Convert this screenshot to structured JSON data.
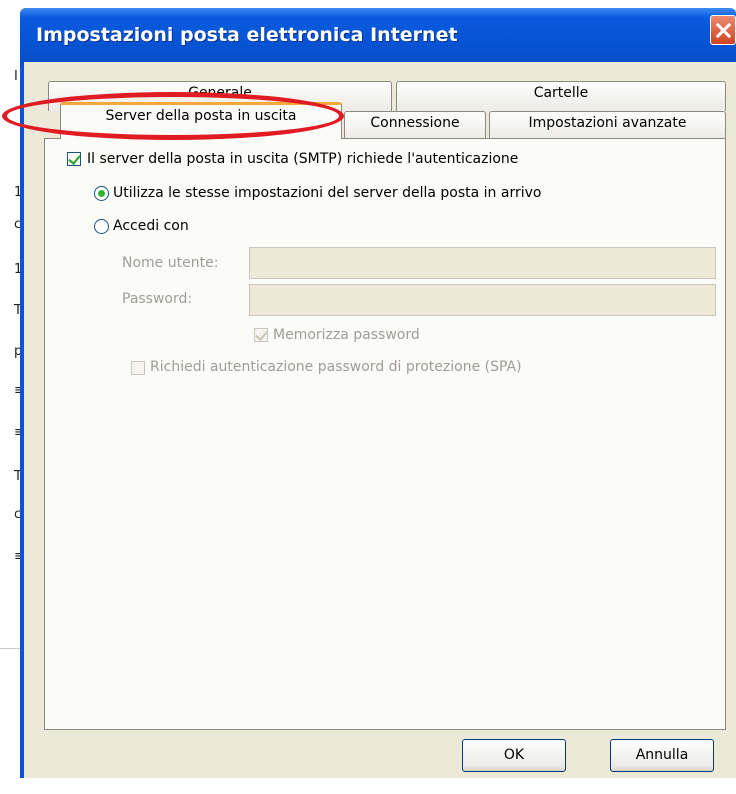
{
  "dialog": {
    "title": "Impostazioni posta elettronica Internet"
  },
  "tabs": {
    "row_back": [
      {
        "label": "Generale"
      },
      {
        "label": "Cartelle"
      }
    ],
    "row_front": [
      {
        "label": "Server della posta in uscita",
        "active": true
      },
      {
        "label": "Connessione"
      },
      {
        "label": "Impostazioni avanzate"
      }
    ]
  },
  "smtp": {
    "auth_required_label": "Il server della posta in uscita (SMTP) richiede l'autenticazione",
    "auth_required_checked": true,
    "use_same_label": "Utilizza le stesse impostazioni del server della posta in arrivo",
    "logon_with_label": "Accedi con",
    "selected_option": "use_same",
    "username_label": "Nome utente:",
    "username_value": "",
    "password_label": "Password:",
    "password_value": "",
    "remember_label": "Memorizza password",
    "remember_checked": true,
    "spa_label": "Richiedi autenticazione password di protezione (SPA)",
    "spa_checked": false
  },
  "buttons": {
    "ok": "OK",
    "cancel": "Annulla"
  },
  "annotation": {
    "color": "#e11b22",
    "shape": "ellipse",
    "target": "Server della posta in uscita"
  },
  "background_glyphs": [
    "I",
    "1",
    "c",
    "1",
    "T",
    "p",
    "≡",
    "≡",
    "T",
    "c",
    "≡"
  ]
}
